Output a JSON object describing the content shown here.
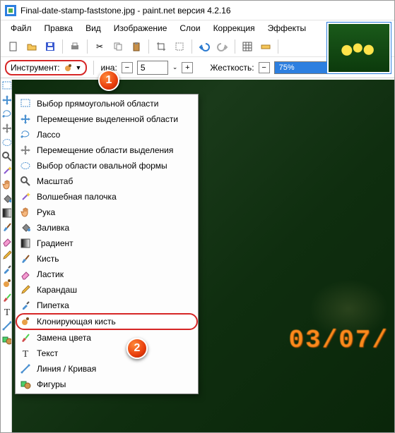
{
  "title": "Final-date-stamp-faststone.jpg - paint.net версия 4.2.16",
  "menu": [
    "Файл",
    "Правка",
    "Вид",
    "Изображение",
    "Слои",
    "Коррекция",
    "Эффекты"
  ],
  "toolbar2": {
    "tool_label": "Инструмент:",
    "width_label": "ина:",
    "width_value": "5",
    "hardness_label": "Жесткость:",
    "hardness_value": "75%"
  },
  "date_stamp": "03/07/",
  "tools": [
    {
      "icon": "rect-select",
      "label": "Выбор прямоугольной области"
    },
    {
      "icon": "move-sel",
      "label": "Перемещение выделенной области"
    },
    {
      "icon": "lasso",
      "label": "Лассо"
    },
    {
      "icon": "move-pix",
      "label": "Перемещение области выделения"
    },
    {
      "icon": "ellipse-select",
      "label": "Выбор области овальной формы"
    },
    {
      "icon": "zoom",
      "label": "Масштаб"
    },
    {
      "icon": "wand",
      "label": "Волшебная палочка"
    },
    {
      "icon": "hand",
      "label": "Рука"
    },
    {
      "icon": "bucket",
      "label": "Заливка"
    },
    {
      "icon": "gradient",
      "label": "Градиент"
    },
    {
      "icon": "brush",
      "label": "Кисть"
    },
    {
      "icon": "eraser",
      "label": "Ластик"
    },
    {
      "icon": "pencil",
      "label": "Карандаш"
    },
    {
      "icon": "eyedrop",
      "label": "Пипетка"
    },
    {
      "icon": "clone",
      "label": "Клонирующая кисть"
    },
    {
      "icon": "recolor",
      "label": "Замена цвета"
    },
    {
      "icon": "text",
      "label": "Текст"
    },
    {
      "icon": "line",
      "label": "Линия / Кривая"
    },
    {
      "icon": "shapes",
      "label": "Фигуры"
    }
  ],
  "highlight_index": 14,
  "badges": {
    "b1": "1",
    "b2": "2"
  }
}
